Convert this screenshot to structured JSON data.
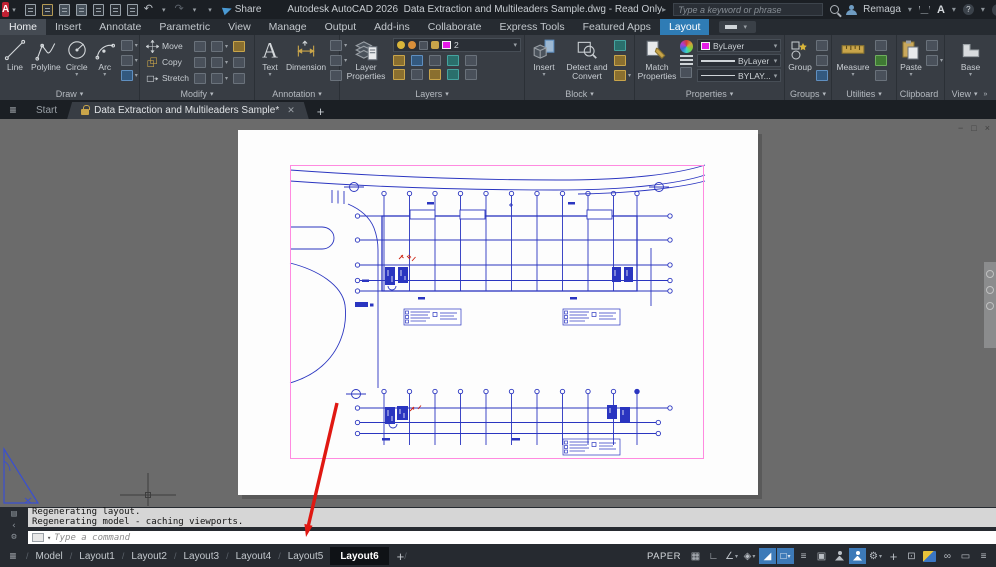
{
  "title_bar": {
    "app_title": "Autodesk AutoCAD 2026",
    "doc_title": "Data Extraction and Multileaders Sample.dwg - Read Only",
    "search_placeholder": "Type a keyword or phrase",
    "user_name": "Remaga",
    "share_label": "Share"
  },
  "ribbon": {
    "tabs": [
      {
        "label": "Home",
        "active": true
      },
      {
        "label": "Insert"
      },
      {
        "label": "Annotate"
      },
      {
        "label": "Parametric"
      },
      {
        "label": "View"
      },
      {
        "label": "Manage"
      },
      {
        "label": "Output"
      },
      {
        "label": "Add-ins"
      },
      {
        "label": "Collaborate"
      },
      {
        "label": "Express Tools"
      },
      {
        "label": "Featured Apps"
      },
      {
        "label": "Layout",
        "highlighted": true
      }
    ],
    "panels": {
      "draw": {
        "label": "Draw",
        "tools": [
          "Line",
          "Polyline",
          "Circle",
          "Arc"
        ]
      },
      "modify": {
        "label": "Modify",
        "tools": [
          "Move",
          "Copy",
          "Stretch"
        ]
      },
      "annotation": {
        "label": "Annotation",
        "tools": [
          "Text",
          "Dimension"
        ]
      },
      "layers": {
        "label": "Layers",
        "main_tool": "Layer Properties",
        "current_layer": "2"
      },
      "block": {
        "label": "Block",
        "tools": [
          "Insert",
          "Detect and Convert"
        ]
      },
      "properties": {
        "label": "Properties",
        "main_tool": "Match Properties",
        "color_value": "ByLayer",
        "lineweight_value": "ByLayer",
        "linetype_value": "BYLAY..."
      },
      "groups": {
        "label": "Groups",
        "main_tool": "Group"
      },
      "utilities": {
        "label": "Utilities",
        "main_tool": "Measure"
      },
      "clipboard": {
        "label": "Clipboard",
        "main_tool": "Paste"
      },
      "view": {
        "label": "View",
        "main_tool": "Base"
      }
    }
  },
  "file_tabs": {
    "start": "Start",
    "active_doc": "Data Extraction and Multileaders Sample*"
  },
  "command_line": {
    "history": [
      "Regenerating layout.",
      "Regenerating model - caching viewports."
    ],
    "placeholder": "Type a command"
  },
  "status_bar": {
    "paper_label": "PAPER",
    "layout_tabs": [
      "Model",
      "Layout1",
      "Layout2",
      "Layout3",
      "Layout4",
      "Layout5",
      "Layout6"
    ],
    "active_layout": "Layout6"
  },
  "icons": {
    "app-logo": "A",
    "share": "paper-plane",
    "search": "magnifier",
    "user": "person-silhouette",
    "undo": "↶",
    "redo": "↷",
    "gear": "⚙",
    "customize": "≡",
    "plus": "+"
  },
  "colors": {
    "highlight_blue": "#2f7cb5",
    "status_active_blue": "#3d7ab8",
    "layer_magenta": "#e61ae6",
    "viewport_pink": "#ff8ae0",
    "drawing_blue": "#2a35c0",
    "arrow_red": "#e01812",
    "canvas_grey": "#6b6b6b",
    "paper_white": "#fdfdfd"
  }
}
